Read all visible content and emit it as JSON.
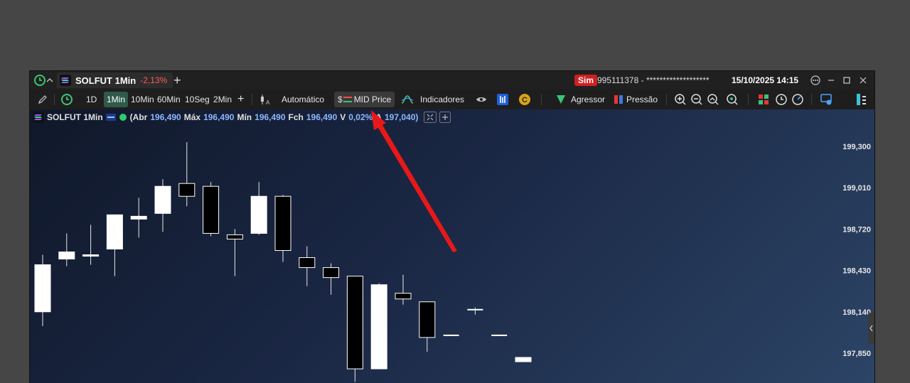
{
  "tab": {
    "symbol": "SOLFUT 1Min",
    "change": "-2,13%",
    "add_tab": "+"
  },
  "account": {
    "mode_badge": "Sim",
    "number": "995111378 - *******************",
    "datetime": "15/10/2025 14:15"
  },
  "toolbar": {
    "periods": [
      "1D",
      "1Min",
      "10Min",
      "60Min",
      "10Seg",
      "2Min"
    ],
    "selected_period": "1Min",
    "add_period": "+",
    "auto_label": "Automático",
    "mid_price_label": "MID Price",
    "mid_price_prefix": "$",
    "indicators_label": "Indicadores",
    "aggressor_label": "Agressor",
    "pressure_label": "Pressão"
  },
  "info": {
    "symbol": "SOLFUT 1Min",
    "open_label": "(Abr",
    "open": "196,490",
    "high_label": "Máx",
    "high": "196,490",
    "low_label": "Mín",
    "low": "196,490",
    "close_label": "Fch",
    "close": "196,490",
    "var_label": "V",
    "var": "0,02%",
    "avg_label": "A",
    "avg": "197,040)"
  },
  "chart_data": {
    "type": "candlestick",
    "y_ticks": [
      "199,300",
      "199,010",
      "198,720",
      "198,430",
      "198,140",
      "197,850"
    ],
    "candles": [
      {
        "open": 198.14,
        "high": 198.54,
        "low": 198.04,
        "close": 198.47
      },
      {
        "open": 198.51,
        "high": 198.69,
        "low": 198.46,
        "close": 198.56
      },
      {
        "open": 198.53,
        "high": 198.75,
        "low": 198.47,
        "close": 198.54
      },
      {
        "open": 198.58,
        "high": 198.81,
        "low": 198.39,
        "close": 198.82
      },
      {
        "open": 198.79,
        "high": 198.94,
        "low": 198.66,
        "close": 198.81
      },
      {
        "open": 198.83,
        "high": 199.07,
        "low": 198.7,
        "close": 199.02
      },
      {
        "open": 199.04,
        "high": 199.33,
        "low": 198.88,
        "close": 198.95
      },
      {
        "open": 199.02,
        "high": 199.05,
        "low": 198.67,
        "close": 198.69
      },
      {
        "open": 198.68,
        "high": 198.72,
        "low": 198.39,
        "close": 198.65
      },
      {
        "open": 198.69,
        "high": 199.05,
        "low": 198.68,
        "close": 198.95
      },
      {
        "open": 198.95,
        "high": 198.96,
        "low": 198.49,
        "close": 198.57
      },
      {
        "open": 198.52,
        "high": 198.6,
        "low": 198.32,
        "close": 198.45
      },
      {
        "open": 198.45,
        "high": 198.48,
        "low": 198.26,
        "close": 198.38
      },
      {
        "open": 198.39,
        "high": 198.39,
        "low": 197.65,
        "close": 197.74
      },
      {
        "open": 197.74,
        "high": 198.34,
        "low": 197.74,
        "close": 198.33
      },
      {
        "open": 198.27,
        "high": 198.4,
        "low": 198.19,
        "close": 198.23
      },
      {
        "open": 198.21,
        "high": 198.21,
        "low": 197.86,
        "close": 197.96
      },
      {
        "open": 197.98,
        "high": 197.98,
        "low": 197.98,
        "close": 197.98
      },
      {
        "open": 198.16,
        "high": 198.17,
        "low": 198.12,
        "close": 198.16
      },
      {
        "open": 197.98,
        "high": 197.98,
        "low": 197.98,
        "close": 197.98
      },
      {
        "open": 197.79,
        "high": 197.82,
        "low": 197.79,
        "close": 197.82
      }
    ],
    "colors": {
      "up": "#ffffff",
      "down": "#000000",
      "wick": "#e8e8e8"
    }
  },
  "colors": {
    "accent_green": "#2f5a4a",
    "negative": "#ff5c5c",
    "info_value": "#8fb6ff",
    "sim_badge": "#d11f1f",
    "annotation_arrow": "#e81818"
  }
}
